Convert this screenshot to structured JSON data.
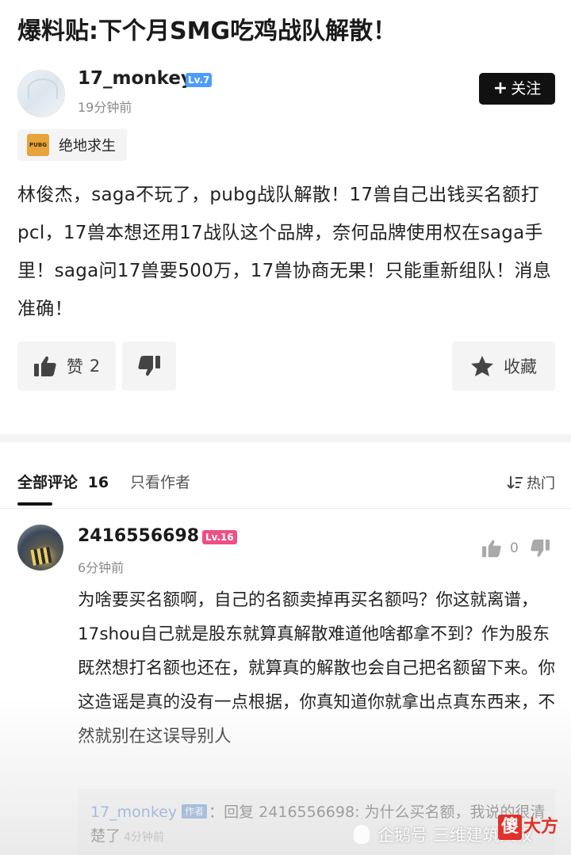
{
  "post": {
    "title": "爆料贴:下个月SMG吃鸡战队解散！",
    "author": {
      "name": "17_monkey",
      "level": "Lv.7",
      "time": "19分钟前"
    },
    "follow_label": "关注",
    "tag": {
      "label": "绝地求生",
      "icon_text": "PUBG"
    },
    "body": "林俊杰，saga不玩了，pubg战队解散！17兽自己出钱买名额打pcl，17兽本想还用17战队这个品牌，奈何品牌使用权在saga手里！saga问17兽要500万，17兽协商无果！只能重新组队！消息准确！",
    "actions": {
      "like_label": "赞",
      "like_count": "2",
      "favorite_label": "收藏"
    }
  },
  "comments_tabs": {
    "all_label": "全部评论",
    "all_count": "16",
    "author_only_label": "只看作者",
    "sort_label": "热门"
  },
  "comment": {
    "user": "2416556698",
    "level": "Lv.16",
    "time": "6分钟前",
    "like_count": "0",
    "text": "为啥要买名额啊，自己的名额卖掉再买名额吗？你这就离谱，17shou自己就是股东就算真解散难道他啥都拿不到？作为股东既然想打名额也还在，就算真的解散也会自己把名额留下来。你这造谣是真的没有一点根据，你真知道你就拿出点真东西来，不然就别在这误导别人",
    "reply": {
      "user": "17_monkey",
      "badge": "作者",
      "prefix": "：回复 2416556698:",
      "text": "为什么买名额，我说的很清楚了",
      "time": "4分钟前"
    }
  },
  "watermark": {
    "text": "企鹅号 三维建筑人权",
    "logo_box": "傻",
    "logo_rest": "大方"
  },
  "colors": {
    "level_blue": "#4d9cff",
    "level_pink": "#ef4f86",
    "reply_name": "#3f7ecf",
    "logo_red": "#e0312b"
  }
}
